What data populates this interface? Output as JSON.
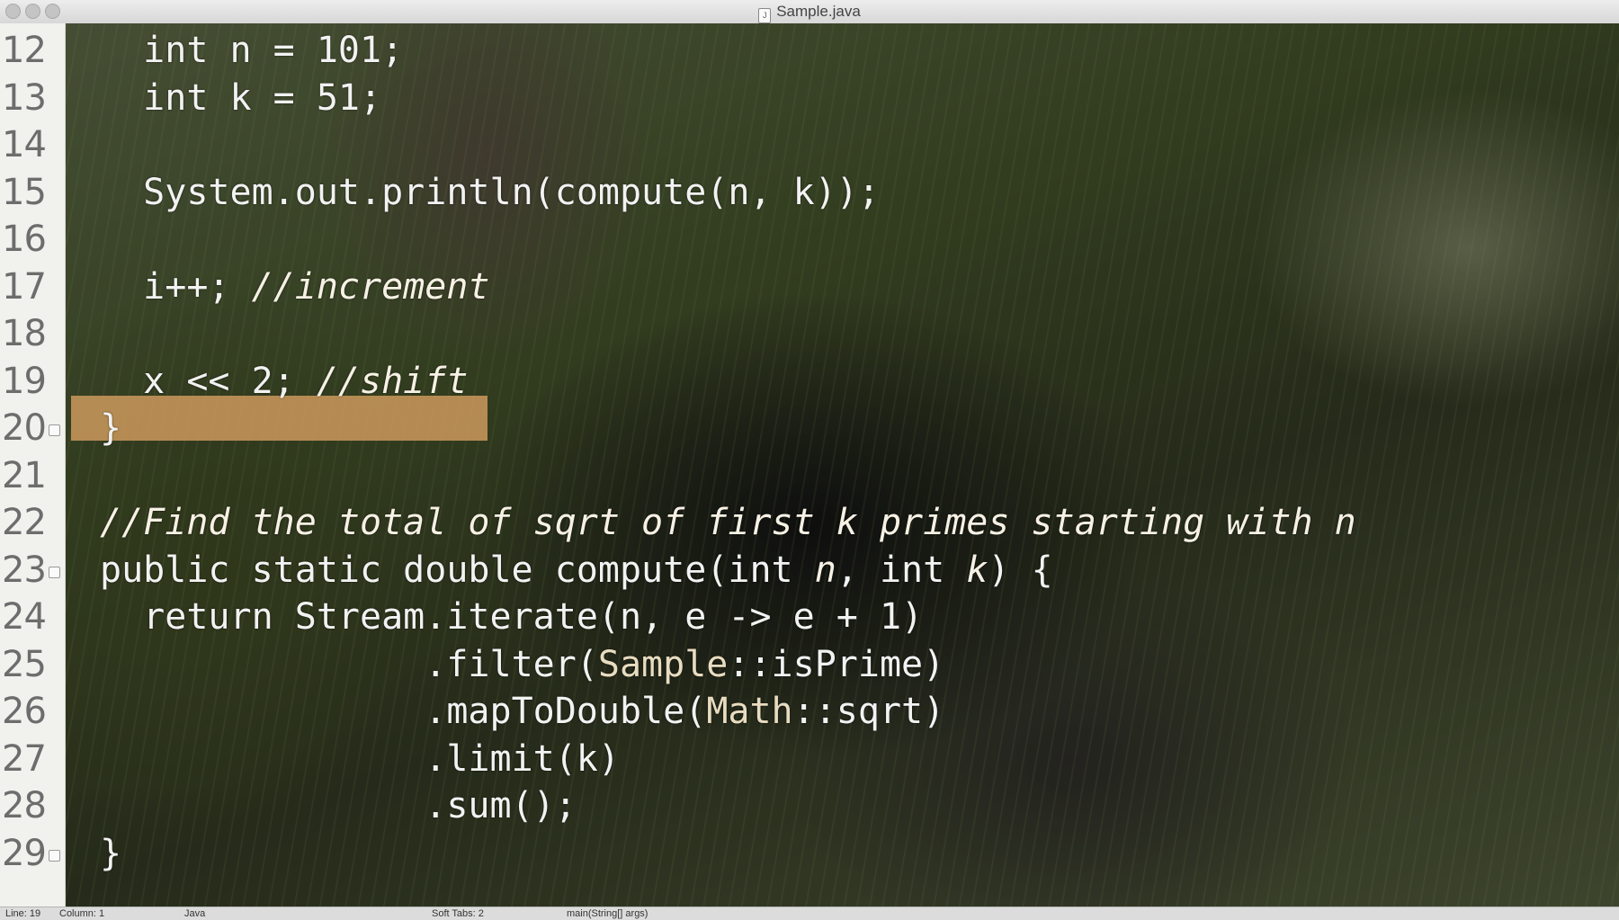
{
  "window": {
    "title": "Sample.java",
    "doc_icon": "J"
  },
  "gutter": {
    "line_numbers": [
      "12",
      "13",
      "14",
      "15",
      "16",
      "17",
      "18",
      "19",
      "20",
      "21",
      "22",
      "23",
      "24",
      "25",
      "26",
      "27",
      "28",
      "29"
    ],
    "fold_markers_on": [
      "20",
      "23",
      "29"
    ]
  },
  "code": {
    "lines": [
      {
        "n": "12",
        "indent": "  ",
        "parts": [
          {
            "t": "int n = 101;",
            "k": "code"
          }
        ]
      },
      {
        "n": "13",
        "indent": "  ",
        "parts": [
          {
            "t": "int k = 51;",
            "k": "code"
          }
        ]
      },
      {
        "n": "14",
        "indent": "",
        "parts": []
      },
      {
        "n": "15",
        "indent": "  ",
        "parts": [
          {
            "t": "System.out.println(compute(n, k));",
            "k": "code"
          }
        ]
      },
      {
        "n": "16",
        "indent": "",
        "parts": []
      },
      {
        "n": "17",
        "indent": "  ",
        "parts": [
          {
            "t": "i++; ",
            "k": "code"
          },
          {
            "t": "//increment",
            "k": "comment"
          }
        ]
      },
      {
        "n": "18",
        "indent": "",
        "parts": []
      },
      {
        "n": "19",
        "indent": "  ",
        "parts": [
          {
            "t": "x << 2; ",
            "k": "code"
          },
          {
            "t": "//shift",
            "k": "comment"
          }
        ],
        "highlighted": true
      },
      {
        "n": "20",
        "indent": "",
        "parts": [
          {
            "t": "}",
            "k": "code"
          }
        ]
      },
      {
        "n": "21",
        "indent": "",
        "parts": []
      },
      {
        "n": "22",
        "indent": "",
        "parts": [
          {
            "t": "//Find the total of sqrt of first k primes starting with n",
            "k": "comment"
          }
        ]
      },
      {
        "n": "23",
        "indent": "",
        "parts": [
          {
            "t": "public static double compute(int ",
            "k": "code"
          },
          {
            "t": "n",
            "k": "comment"
          },
          {
            "t": ", int ",
            "k": "code"
          },
          {
            "t": "k",
            "k": "comment"
          },
          {
            "t": ") {",
            "k": "code"
          }
        ]
      },
      {
        "n": "24",
        "indent": "  ",
        "parts": [
          {
            "t": "return Stream.iterate(n, e -> e + 1)",
            "k": "code"
          }
        ]
      },
      {
        "n": "25",
        "indent": "               ",
        "parts": [
          {
            "t": ".filter(",
            "k": "code"
          },
          {
            "t": "Sample",
            "k": "ref"
          },
          {
            "t": "::isPrime)",
            "k": "code"
          }
        ]
      },
      {
        "n": "26",
        "indent": "               ",
        "parts": [
          {
            "t": ".mapToDouble(",
            "k": "code"
          },
          {
            "t": "Math",
            "k": "ref"
          },
          {
            "t": "::sqrt)",
            "k": "code"
          }
        ]
      },
      {
        "n": "27",
        "indent": "               ",
        "parts": [
          {
            "t": ".limit(k)",
            "k": "code"
          }
        ]
      },
      {
        "n": "28",
        "indent": "               ",
        "parts": [
          {
            "t": ".sum();",
            "k": "code"
          }
        ]
      },
      {
        "n": "29",
        "indent": "",
        "parts": [
          {
            "t": "}",
            "k": "code"
          }
        ]
      }
    ]
  },
  "status_bar": {
    "line": "Line: 19",
    "column": "Column: 1",
    "language": "Java",
    "tabs": "Soft Tabs: 2",
    "symbol": "main(String[] args)"
  },
  "colors": {
    "highlight": "#c09358",
    "gutter_bg": "#f1f1ee",
    "code_text": "#f2f2f2"
  }
}
